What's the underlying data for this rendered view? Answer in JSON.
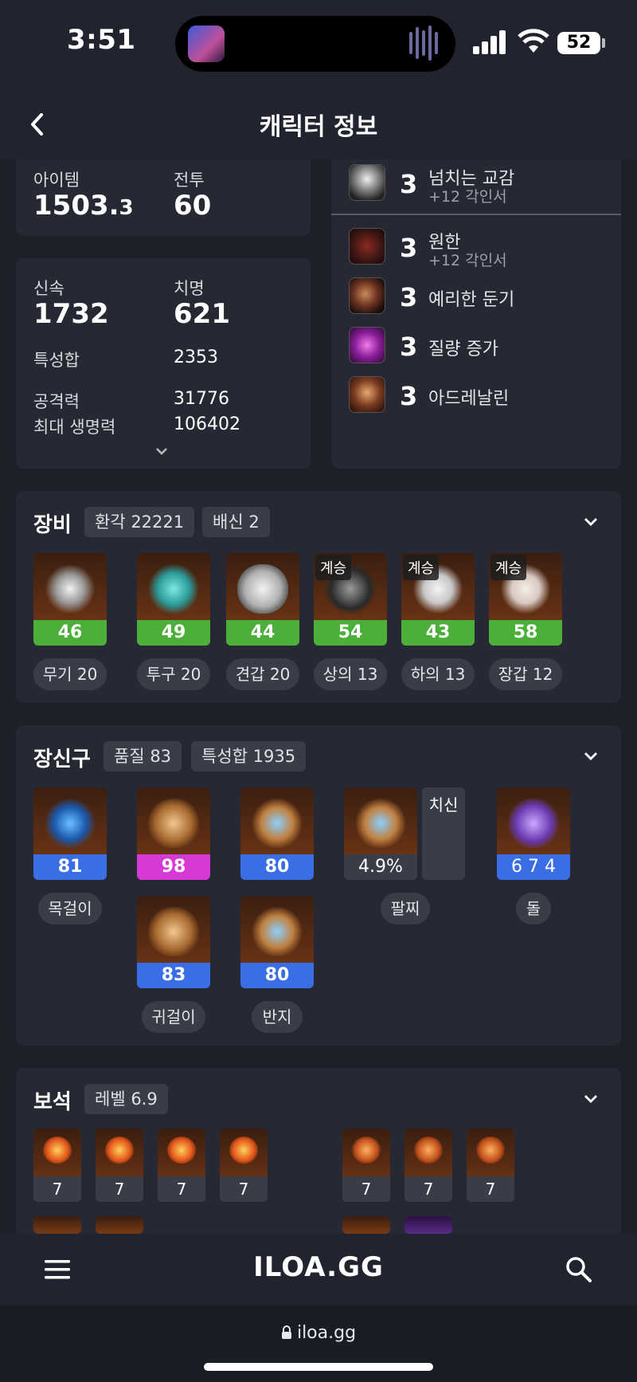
{
  "status": {
    "time": "3:51",
    "battery": "52"
  },
  "header": {
    "title": "캐릭터 정보"
  },
  "level_card": {
    "item_label": "아이템",
    "item_value": "1503.",
    "item_decimal": "3",
    "combat_label": "전투",
    "combat_value": "60"
  },
  "stats_card": {
    "swift_label": "신속",
    "swift_value": "1732",
    "crit_label": "치명",
    "crit_value": "621",
    "stat_sum_label": "특성합",
    "stat_sum_value": "2353",
    "attack_label": "공격력",
    "attack_value": "31776",
    "hp_label": "최대 생명력",
    "hp_value": "106402"
  },
  "engravings": [
    {
      "level": "3",
      "name": "넘치는 교감",
      "sub": "+12 각인서",
      "icon": "spirit-figure-icon"
    },
    {
      "level": "3",
      "name": "원한",
      "sub": "+12 각인서",
      "icon": "demon-face-icon"
    },
    {
      "level": "3",
      "name": "예리한 둔기",
      "sub": "",
      "icon": "blunt-orb-icon"
    },
    {
      "level": "3",
      "name": "질량 증가",
      "sub": "",
      "icon": "purple-gauntlet-icon"
    },
    {
      "level": "3",
      "name": "아드레날린",
      "sub": "",
      "icon": "runner-icon"
    }
  ],
  "equipment": {
    "title": "장비",
    "chips": [
      "환각 22221",
      "배신 2"
    ],
    "items": [
      {
        "value": "46",
        "label": "무기 20",
        "tag": "",
        "icon": "weapon-staff-icon"
      },
      {
        "value": "49",
        "label": "투구 20",
        "tag": "",
        "icon": "helmet-butterfly-icon"
      },
      {
        "value": "44",
        "label": "견갑 20",
        "tag": "",
        "icon": "shoulder-icon"
      },
      {
        "value": "54",
        "label": "상의 13",
        "tag": "계승",
        "icon": "chest-armor-icon"
      },
      {
        "value": "43",
        "label": "하의 13",
        "tag": "계승",
        "icon": "pants-icon"
      },
      {
        "value": "58",
        "label": "장갑 12",
        "tag": "계승",
        "icon": "glove-icon"
      }
    ]
  },
  "accessories": {
    "title": "장신구",
    "chips": [
      "품질 83",
      "특성합 1935"
    ],
    "necklace": {
      "value": "81",
      "label": "목걸이"
    },
    "earrings": {
      "values": [
        "98",
        "83"
      ],
      "label": "귀걸이"
    },
    "rings": {
      "values": [
        "80",
        "80"
      ],
      "label": "반지"
    },
    "bracelet": {
      "value": "4.9%",
      "side": "치신",
      "label": "팔찌"
    },
    "stone": {
      "value": "6 7 4",
      "label": "돌"
    }
  },
  "gems": {
    "title": "보석",
    "chip": "레벨 6.9",
    "levels_left": [
      "7",
      "7",
      "7",
      "7"
    ],
    "levels_right": [
      "7",
      "7",
      "7"
    ]
  },
  "bottom": {
    "brand": "ILOA.GG",
    "url": "iloa.gg"
  },
  "colors": {
    "green": "#4caf3a",
    "blue": "#3a6ee6",
    "magenta": "#d63ad6"
  }
}
